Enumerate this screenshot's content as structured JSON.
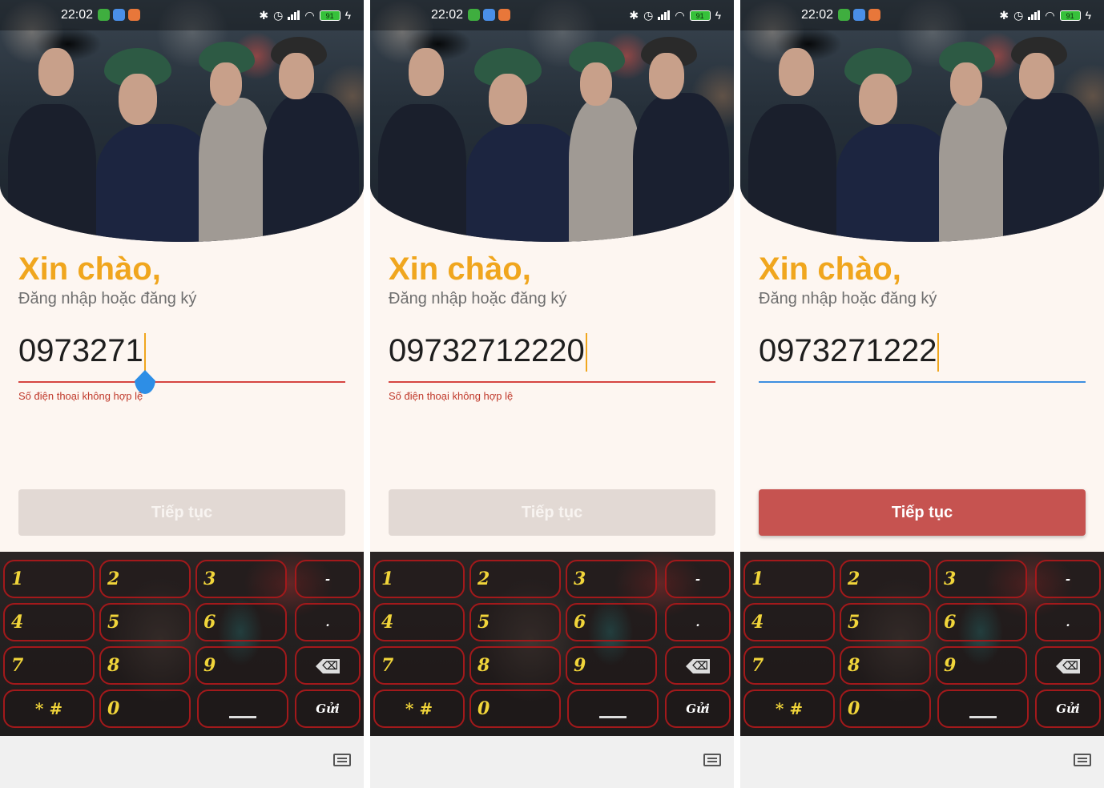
{
  "status_bar": {
    "time": "22:02",
    "battery": "91"
  },
  "login": {
    "greeting": "Xin chào,",
    "subtitle": "Đăng nhập hoặc đăng ký",
    "continue_label": "Tiếp tục",
    "error_text": "Số điện thoại không hợp lệ"
  },
  "screens": [
    {
      "phone_value": "0973271",
      "has_error": true,
      "continue_enabled": false
    },
    {
      "phone_value": "09732712220",
      "has_error": true,
      "continue_enabled": false
    },
    {
      "phone_value": "0973271222",
      "has_error": false,
      "continue_enabled": true
    }
  ],
  "keyboard": {
    "keys": [
      "1",
      "2",
      "3",
      "-",
      "4",
      "5",
      "6",
      ".",
      "7",
      "8",
      "9",
      "⌫",
      "* #",
      "0",
      "",
      "Gửi"
    ]
  },
  "icons": {
    "bluetooth": "bluetooth-icon",
    "alarm": "alarm-icon",
    "signal": "signal-icon",
    "wifi": "wifi-icon",
    "keyboard": "keyboard-icon",
    "backspace": "backspace-icon"
  },
  "colors": {
    "accent": "#f0a61e",
    "error": "#d64541",
    "focus": "#3d8fe0",
    "button_enabled": "#c65350",
    "button_disabled": "#e2d9d4",
    "key_border": "#a3191b",
    "key_text": "#f1d53a"
  }
}
